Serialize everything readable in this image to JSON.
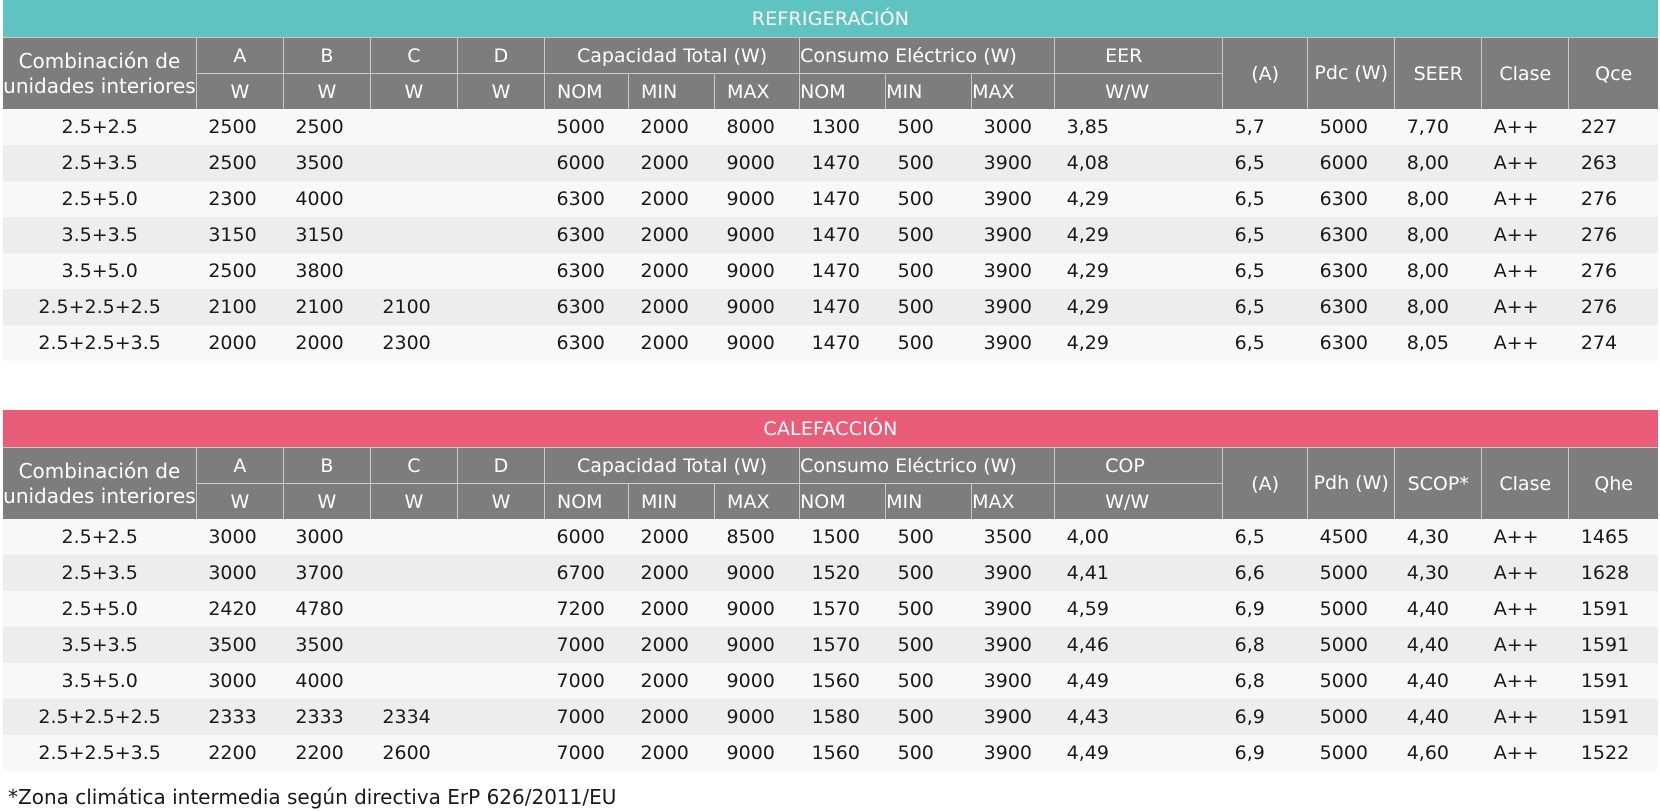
{
  "refrigeracion": {
    "title": "REFRIGERACIÓN",
    "headers": {
      "combination": "Combinación de unidades interiores",
      "a": "A",
      "b": "B",
      "c": "C",
      "d": "D",
      "w": "W",
      "capacity_total": "Capacidad Total (W)",
      "consumption": "Consumo Eléctrico (W)",
      "ratio": "EER",
      "ratio_unit": "W/W",
      "nom": "NOM",
      "min": "MIN",
      "max": "MAX",
      "amps": "(A)",
      "p_design": "Pdc (W)",
      "seasonal": "SEER",
      "clase": "Clase",
      "q": "Qce"
    },
    "rows": [
      [
        "2.5+2.5",
        "2500",
        "2500",
        "",
        "",
        "5000",
        "2000",
        "8000",
        "1300",
        "500",
        "3000",
        "3,85",
        "5,7",
        "5000",
        "7,70",
        "A++",
        "227"
      ],
      [
        "2.5+3.5",
        "2500",
        "3500",
        "",
        "",
        "6000",
        "2000",
        "9000",
        "1470",
        "500",
        "3900",
        "4,08",
        "6,5",
        "6000",
        "8,00",
        "A++",
        "263"
      ],
      [
        "2.5+5.0",
        "2300",
        "4000",
        "",
        "",
        "6300",
        "2000",
        "9000",
        "1470",
        "500",
        "3900",
        "4,29",
        "6,5",
        "6300",
        "8,00",
        "A++",
        "276"
      ],
      [
        "3.5+3.5",
        "3150",
        "3150",
        "",
        "",
        "6300",
        "2000",
        "9000",
        "1470",
        "500",
        "3900",
        "4,29",
        "6,5",
        "6300",
        "8,00",
        "A++",
        "276"
      ],
      [
        "3.5+5.0",
        "2500",
        "3800",
        "",
        "",
        "6300",
        "2000",
        "9000",
        "1470",
        "500",
        "3900",
        "4,29",
        "6,5",
        "6300",
        "8,00",
        "A++",
        "276"
      ],
      [
        "2.5+2.5+2.5",
        "2100",
        "2100",
        "2100",
        "",
        "6300",
        "2000",
        "9000",
        "1470",
        "500",
        "3900",
        "4,29",
        "6,5",
        "6300",
        "8,00",
        "A++",
        "276"
      ],
      [
        "2.5+2.5+3.5",
        "2000",
        "2000",
        "2300",
        "",
        "6300",
        "2000",
        "9000",
        "1470",
        "500",
        "3900",
        "4,29",
        "6,5",
        "6300",
        "8,05",
        "A++",
        "274"
      ]
    ]
  },
  "calefaccion": {
    "title": "CALEFACCIÓN",
    "headers": {
      "combination": "Combinación de unidades interiores",
      "a": "A",
      "b": "B",
      "c": "C",
      "d": "D",
      "w": "W",
      "capacity_total": "Capacidad Total (W)",
      "consumption": "Consumo Eléctrico (W)",
      "ratio": "COP",
      "ratio_unit": "W/W",
      "nom": "NOM",
      "min": "MIN",
      "max": "MAX",
      "amps": "(A)",
      "p_design": "Pdh (W)",
      "seasonal": "SCOP*",
      "clase": "Clase",
      "q": "Qhe"
    },
    "rows": [
      [
        "2.5+2.5",
        "3000",
        "3000",
        "",
        "",
        "6000",
        "2000",
        "8500",
        "1500",
        "500",
        "3500",
        "4,00",
        "6,5",
        "4500",
        "4,30",
        "A++",
        "1465"
      ],
      [
        "2.5+3.5",
        "3000",
        "3700",
        "",
        "",
        "6700",
        "2000",
        "9000",
        "1520",
        "500",
        "3900",
        "4,41",
        "6,6",
        "5000",
        "4,30",
        "A++",
        "1628"
      ],
      [
        "2.5+5.0",
        "2420",
        "4780",
        "",
        "",
        "7200",
        "2000",
        "9000",
        "1570",
        "500",
        "3900",
        "4,59",
        "6,9",
        "5000",
        "4,40",
        "A++",
        "1591"
      ],
      [
        "3.5+3.5",
        "3500",
        "3500",
        "",
        "",
        "7000",
        "2000",
        "9000",
        "1570",
        "500",
        "3900",
        "4,46",
        "6,8",
        "5000",
        "4,40",
        "A++",
        "1591"
      ],
      [
        "3.5+5.0",
        "3000",
        "4000",
        "",
        "",
        "7000",
        "2000",
        "9000",
        "1560",
        "500",
        "3900",
        "4,49",
        "6,8",
        "5000",
        "4,40",
        "A++",
        "1591"
      ],
      [
        "2.5+2.5+2.5",
        "2333",
        "2333",
        "2334",
        "",
        "7000",
        "2000",
        "9000",
        "1580",
        "500",
        "3900",
        "4,43",
        "6,9",
        "5000",
        "4,40",
        "A++",
        "1591"
      ],
      [
        "2.5+2.5+3.5",
        "2200",
        "2200",
        "2600",
        "",
        "7000",
        "2000",
        "9000",
        "1560",
        "500",
        "3900",
        "4,49",
        "6,9",
        "5000",
        "4,60",
        "A++",
        "1522"
      ]
    ]
  },
  "footnote": "*Zona climática intermedia según directiva ErP 626/2011/EU"
}
